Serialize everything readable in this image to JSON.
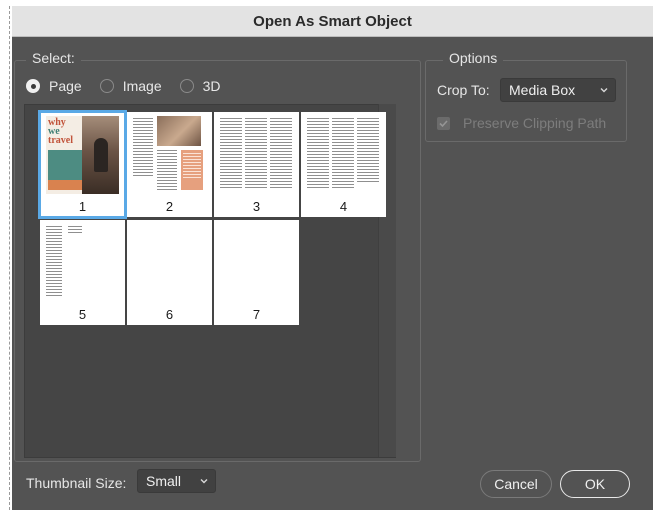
{
  "dialog": {
    "title": "Open As Smart Object"
  },
  "select": {
    "legend": "Select:",
    "radios": [
      {
        "label": "Page",
        "checked": true
      },
      {
        "label": "Image",
        "checked": false
      },
      {
        "label": "3D",
        "checked": false
      }
    ]
  },
  "thumbnails": {
    "pages": [
      {
        "number": "1",
        "selected": true,
        "cover_text": [
          "why",
          "we",
          "travel"
        ]
      },
      {
        "number": "2",
        "selected": false
      },
      {
        "number": "3",
        "selected": false
      },
      {
        "number": "4",
        "selected": false
      },
      {
        "number": "5",
        "selected": false
      },
      {
        "number": "6",
        "selected": false
      },
      {
        "number": "7",
        "selected": false
      }
    ]
  },
  "options": {
    "legend": "Options",
    "crop_label": "Crop To:",
    "crop_value": "Media Box",
    "preserve_label": "Preserve Clipping Path",
    "preserve_checked": true,
    "preserve_enabled": false
  },
  "footer": {
    "thumb_size_label": "Thumbnail Size:",
    "thumb_size_value": "Small",
    "cancel_label": "Cancel",
    "ok_label": "OK"
  },
  "colors": {
    "dialog_bg": "#535353",
    "title_bg": "#e3e3e3",
    "selection": "#5aa9e6",
    "cover_teal": "#4d8c82",
    "cover_orange": "#d9824f"
  }
}
